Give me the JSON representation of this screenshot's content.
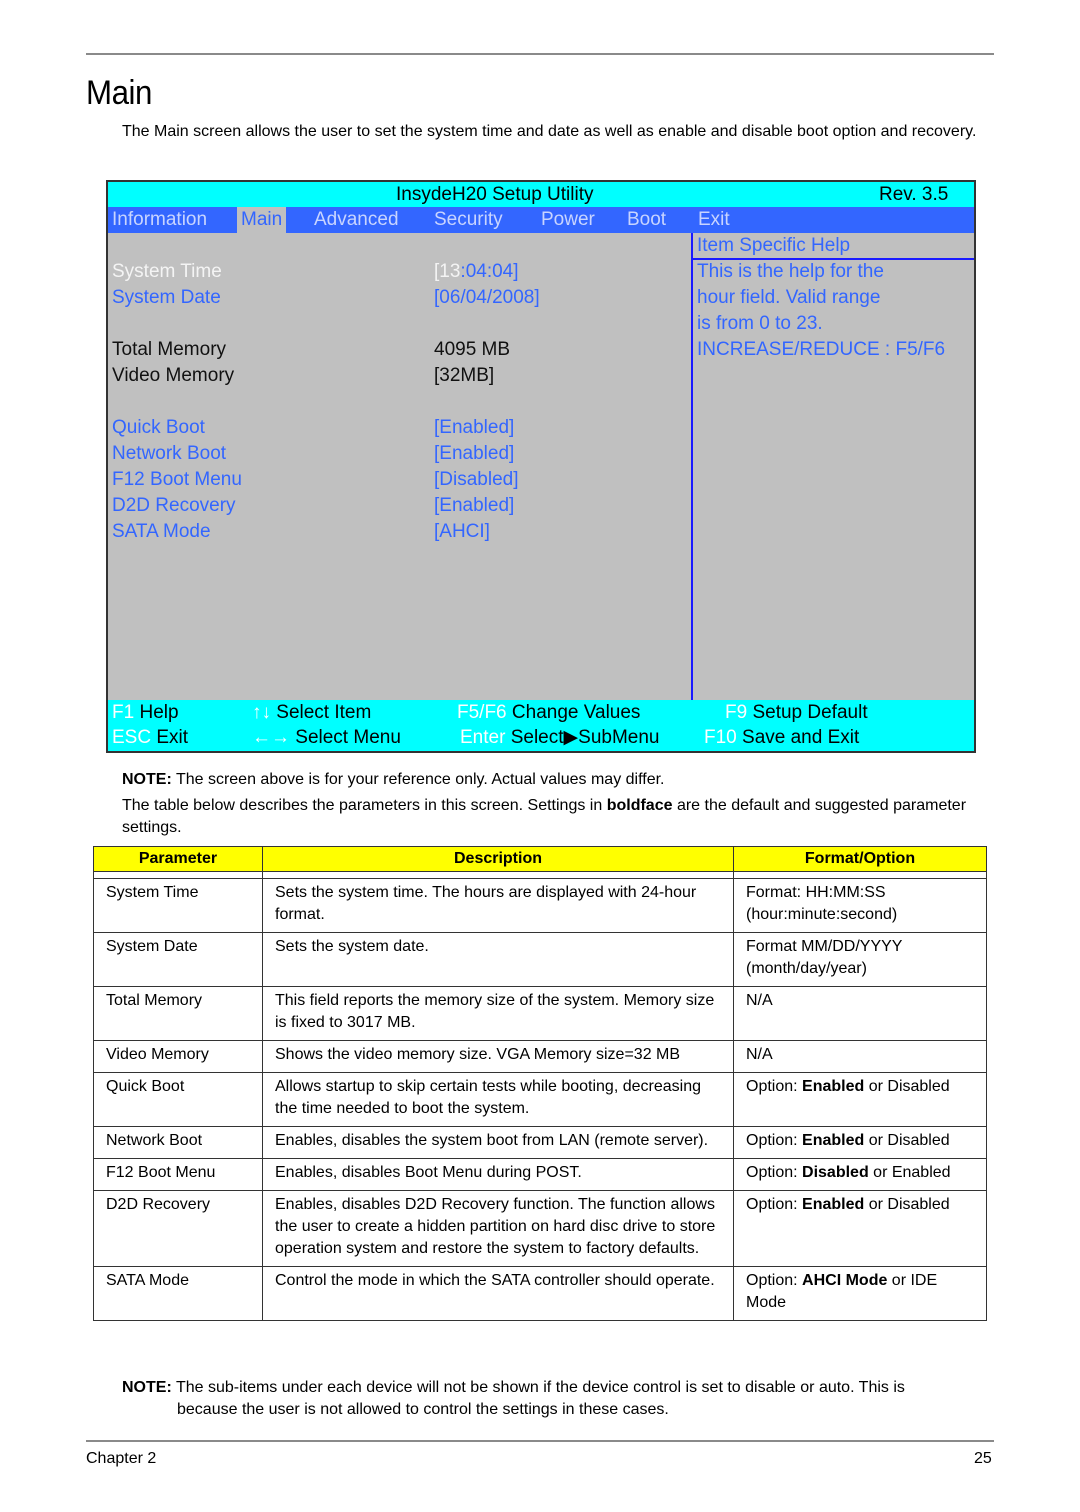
{
  "page": {
    "title": "Main",
    "intro": "The Main screen allows the user to set the system time and date as well as enable and disable boot option and recovery.",
    "note1_label": "NOTE:",
    "note1_text": " The screen above is for your reference only. Actual values may differ.",
    "table_intro_before": "The table below describes the parameters in this screen. Settings in ",
    "table_intro_bold": "boldface",
    "table_intro_after": " are the default and suggested parameter settings.",
    "note2_label": "NOTE:",
    "note2_text_line1": " The sub-items under each device will not be shown if the device control is set to disable or auto. This is",
    "note2_text_line2": "because the user is not allowed to control the settings in these cases.",
    "footer_left": "Chapter 2",
    "footer_right": "25"
  },
  "bios": {
    "title": "InsydeH20 Setup Utility",
    "revision": "Rev. 3.5",
    "tabs": [
      {
        "label": "Information"
      },
      {
        "label": "Main"
      },
      {
        "label": "Advanced"
      },
      {
        "label": "Security"
      },
      {
        "label": "Power"
      },
      {
        "label": "Boot"
      },
      {
        "label": "Exit"
      }
    ],
    "active_tab": "Main",
    "items": {
      "system_time": {
        "label": "System Time",
        "value_open": "[",
        "value_hour": "13",
        "value_rest": ":04:04",
        "value_close": "]"
      },
      "system_date": {
        "label": "System Date",
        "value": "[06/04/2008]"
      },
      "total_memory": {
        "label": "Total Memory",
        "value": "4095 MB"
      },
      "video_memory": {
        "label": "Video Memory",
        "value": "[32MB]"
      },
      "quick_boot": {
        "label": "Quick Boot",
        "value": "[Enabled]"
      },
      "network_boot": {
        "label": "Network Boot",
        "value": "[Enabled]"
      },
      "f12_boot_menu": {
        "label": "F12 Boot Menu",
        "value": "[Disabled]"
      },
      "d2d_recovery": {
        "label": "D2D Recovery",
        "value": "[Enabled]"
      },
      "sata_mode": {
        "label": "SATA Mode",
        "value": "[AHCI]"
      }
    },
    "help": {
      "title": "Item Specific Help",
      "lines": [
        "This is the help for the",
        "hour field. Valid range",
        "is from 0 to 23.",
        "INCREASE/REDUCE : F5/F6"
      ]
    },
    "footer": {
      "f1_key": "F1",
      "f1_label": " Help",
      "esc_key": "ESC",
      "esc_label": " Exit",
      "updown_key": "↑↓",
      "updown_label": " Select Item",
      "leftright_key": "←→",
      "leftright_label": " Select Menu",
      "f5f6_key": "F5/F6",
      "f5f6_label": " Change Values",
      "enter_key": "Enter",
      "enter_label": " Select",
      "submenu_arrow": "▶",
      "submenu_label": "SubMenu",
      "f9_key": "F9",
      "f9_label": " Setup Default",
      "f10_key": "F10",
      "f10_label": " Save and Exit"
    },
    "colors": {
      "title_bar": "#00ffff",
      "menu_bar": "#3366ff",
      "body_bg": "#c0c0c0",
      "selectable_text": "#3366ff",
      "selected_text": "#ffffff"
    }
  },
  "table": {
    "headers": [
      "Parameter",
      "Description",
      "Format/Option"
    ],
    "header_color": "#ffff00",
    "rows": [
      {
        "param": "System Time",
        "desc": "Sets the system time. The hours are displayed with 24-hour format.",
        "opt_before": "Format: HH:MM:SS (hour:minute:second)",
        "opt_bold": "",
        "opt_after": ""
      },
      {
        "param": "System Date",
        "desc": "Sets the system date.",
        "opt_before": "Format MM/DD/YYYY (month/day/year)",
        "opt_bold": "",
        "opt_after": ""
      },
      {
        "param": "Total Memory",
        "desc": "This field reports the memory size of the system. Memory size is fixed to 3017 MB.",
        "opt_before": "N/A",
        "opt_bold": "",
        "opt_after": ""
      },
      {
        "param": "Video Memory",
        "desc": "Shows the video memory size. VGA Memory size=32 MB",
        "opt_before": "N/A",
        "opt_bold": "",
        "opt_after": ""
      },
      {
        "param": "Quick Boot",
        "desc": "Allows startup to skip certain tests while booting, decreasing the time needed to boot the system.",
        "opt_before": "Option: ",
        "opt_bold": "Enabled",
        "opt_after": " or Disabled"
      },
      {
        "param": "Network Boot",
        "desc": "Enables, disables the system boot from LAN (remote server).",
        "opt_before": "Option: ",
        "opt_bold": "Enabled",
        "opt_after": " or Disabled"
      },
      {
        "param": "F12 Boot Menu",
        "desc": "Enables, disables Boot Menu during POST.",
        "opt_before": "Option: ",
        "opt_bold": "Disabled",
        "opt_after": " or Enabled"
      },
      {
        "param": "D2D Recovery",
        "desc": "Enables, disables D2D Recovery function. The function allows the user to create a hidden partition on hard disc drive to store operation system and restore the system to factory defaults.",
        "opt_before": "Option: ",
        "opt_bold": "Enabled",
        "opt_after": " or Disabled"
      },
      {
        "param": "SATA Mode",
        "desc": "Control the mode in which the SATA controller should operate.",
        "opt_before": "Option: ",
        "opt_bold": "AHCI Mode",
        "opt_after": " or IDE Mode"
      }
    ]
  }
}
